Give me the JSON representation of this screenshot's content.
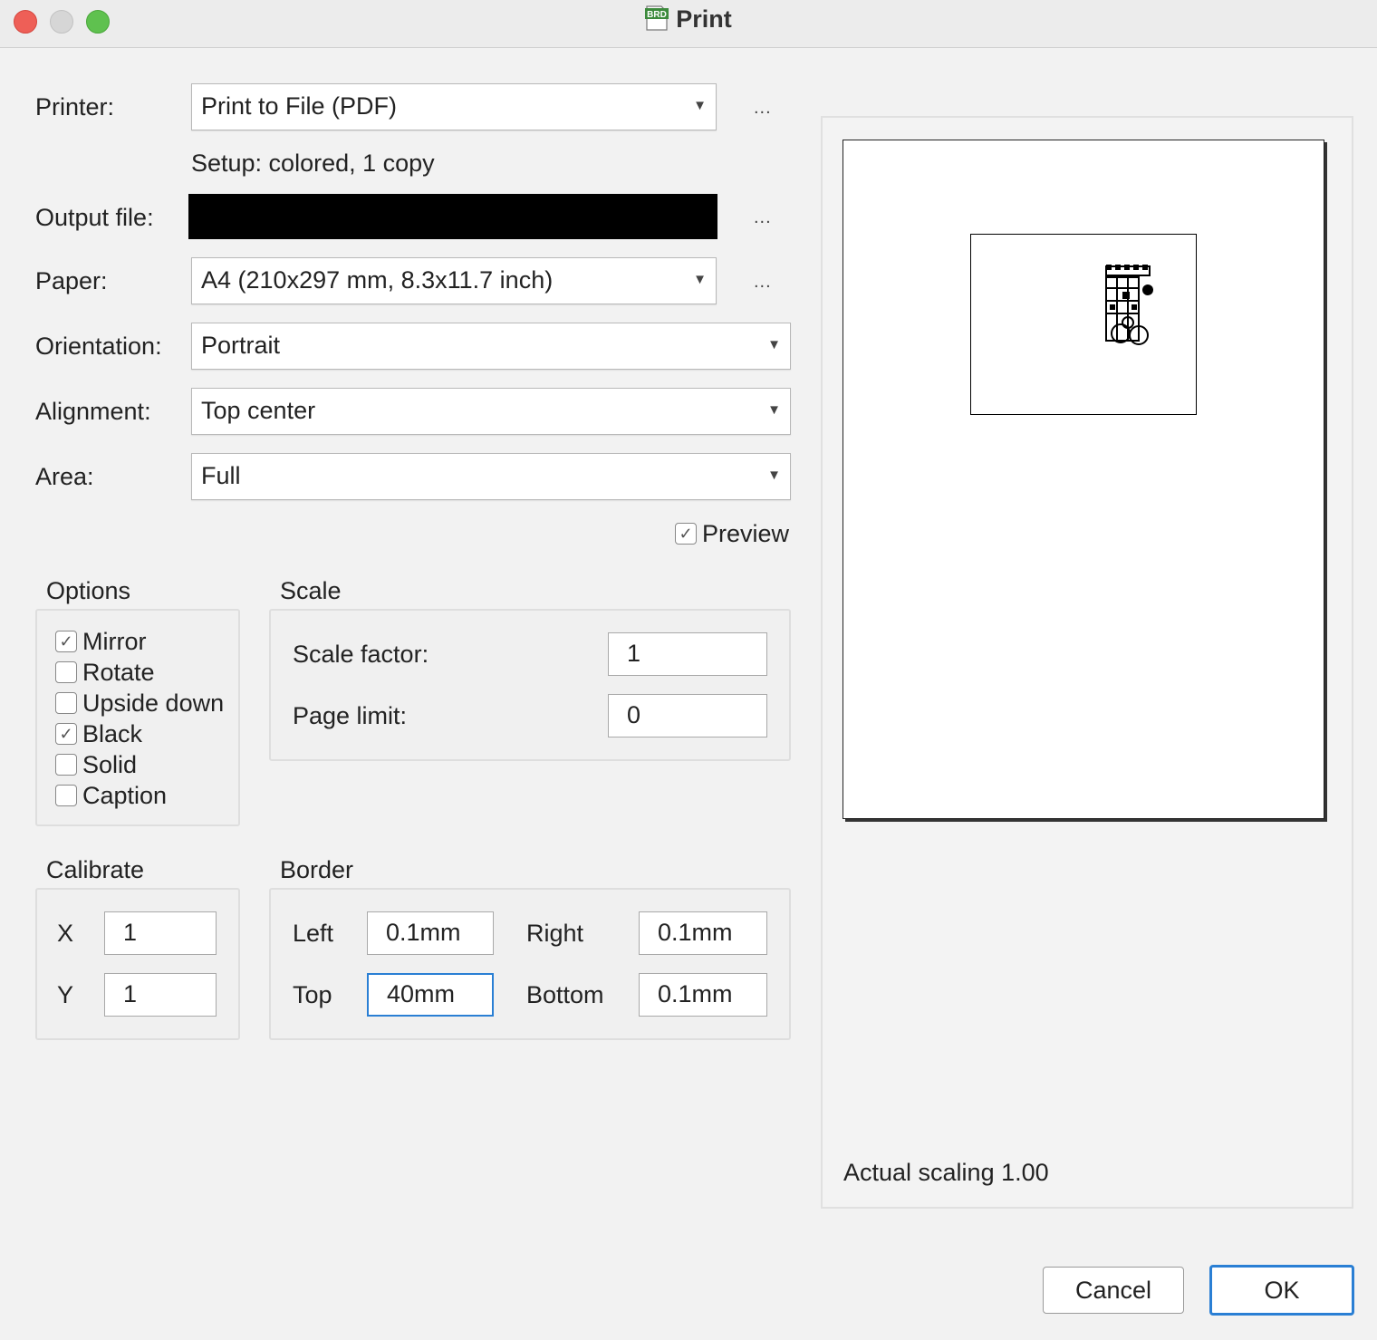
{
  "window": {
    "title": "Print",
    "icon_text": "BRD"
  },
  "form": {
    "printer_label": "Printer:",
    "printer_value": "Print to File (PDF)",
    "setup_text": "Setup: colored, 1 copy",
    "output_label": "Output file:",
    "paper_label": "Paper:",
    "paper_value": "A4 (210x297 mm, 8.3x11.7 inch)",
    "orientation_label": "Orientation:",
    "orientation_value": "Portrait",
    "alignment_label": "Alignment:",
    "alignment_value": "Top center",
    "area_label": "Area:",
    "area_value": "Full",
    "more_button": "...",
    "preview_label": "Preview",
    "preview_checked": true
  },
  "options": {
    "title": "Options",
    "items": [
      {
        "label": "Mirror",
        "checked": true
      },
      {
        "label": "Rotate",
        "checked": false
      },
      {
        "label": "Upside down",
        "checked": false
      },
      {
        "label": "Black",
        "checked": true
      },
      {
        "label": "Solid",
        "checked": false
      },
      {
        "label": "Caption",
        "checked": false
      }
    ]
  },
  "scale": {
    "title": "Scale",
    "factor_label": "Scale factor:",
    "factor_value": "1",
    "limit_label": "Page limit:",
    "limit_value": "0"
  },
  "calibrate": {
    "title": "Calibrate",
    "x_label": "X",
    "x_value": "1",
    "y_label": "Y",
    "y_value": "1"
  },
  "border": {
    "title": "Border",
    "left_label": "Left",
    "left_value": "0.1mm",
    "right_label": "Right",
    "right_value": "0.1mm",
    "top_label": "Top",
    "top_value": "40mm",
    "bottom_label": "Bottom",
    "bottom_value": "0.1mm"
  },
  "preview": {
    "scaling_text": "Actual scaling 1.00"
  },
  "buttons": {
    "cancel": "Cancel",
    "ok": "OK"
  },
  "colors": {
    "accent": "#2a7fd4",
    "close": "#ee5f57",
    "minimize": "#d6d6d6",
    "zoom": "#5fc14f"
  }
}
